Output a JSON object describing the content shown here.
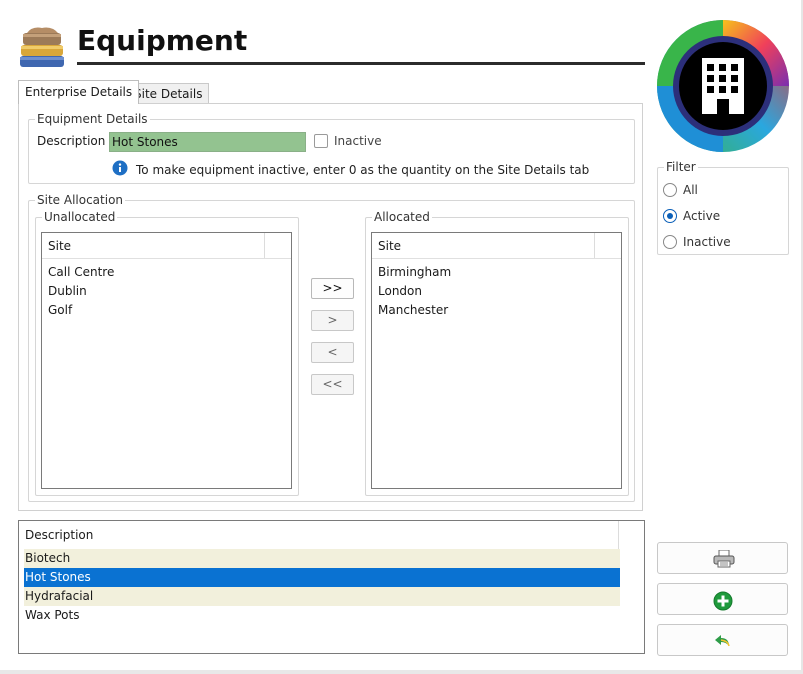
{
  "header": {
    "title": "Equipment"
  },
  "tabs": [
    {
      "label": "Enterprise Details",
      "active": true
    },
    {
      "label": "Site Details",
      "active": false
    }
  ],
  "equipment_details": {
    "legend": "Equipment Details",
    "description_label": "Description",
    "description_value": "Hot Stones",
    "inactive_label": "Inactive",
    "inactive_checked": false,
    "info_text": "To make equipment inactive, enter 0 as the quantity on the Site Details tab"
  },
  "site_allocation": {
    "legend": "Site Allocation",
    "unallocated": {
      "legend": "Unallocated",
      "column": "Site",
      "items": [
        "Call Centre",
        "Dublin",
        "Golf"
      ]
    },
    "allocated": {
      "legend": "Allocated",
      "column": "Site",
      "items": [
        "Birmingham",
        "London",
        "Manchester"
      ]
    },
    "buttons": {
      "move_all_right": ">>",
      "move_right": ">",
      "move_left": "<",
      "move_all_left": "<<"
    }
  },
  "filter": {
    "legend": "Filter",
    "options": [
      {
        "label": "All",
        "selected": false
      },
      {
        "label": "Active",
        "selected": true
      },
      {
        "label": "Inactive",
        "selected": false
      }
    ]
  },
  "equipment_list": {
    "column": "Description",
    "rows": [
      {
        "label": "Biotech",
        "style": "alt"
      },
      {
        "label": "Hot Stones",
        "style": "selected"
      },
      {
        "label": "Hydrafacial",
        "style": "alt"
      },
      {
        "label": "Wax Pots",
        "style": "plain"
      }
    ]
  },
  "side_buttons": {
    "print": "printer-icon",
    "add": "add-circle-icon",
    "undo": "undo-icon"
  },
  "colors": {
    "accent": "#0a72d2",
    "description_field": "#93c390",
    "alt_row": "#f2f0dc",
    "add_green": "#1f9a3c"
  }
}
